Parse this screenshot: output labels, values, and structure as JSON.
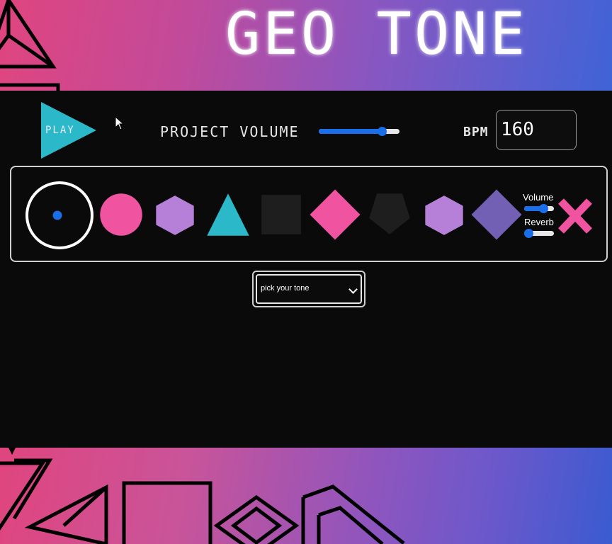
{
  "app": {
    "title": "GEO TONE"
  },
  "controls": {
    "play_label": "PLAY",
    "project_volume_label": "PROJECT VOLUME",
    "project_volume": 0.78,
    "bpm_label": "BPM",
    "bpm_value": "160"
  },
  "sequencer": {
    "steps": [
      {
        "shape": "ring-with-dot",
        "color": "#ffffff",
        "dot_color": "#1a6ee8"
      },
      {
        "shape": "circle",
        "color": "#f0539f"
      },
      {
        "shape": "hexagon",
        "color": "#b67fd8"
      },
      {
        "shape": "triangle",
        "color": "#2bb8c8"
      },
      {
        "shape": "square",
        "color": "#1e1e1e"
      },
      {
        "shape": "diamond",
        "color": "#f0539f"
      },
      {
        "shape": "pentagon",
        "color": "#1e1e1e"
      },
      {
        "shape": "hexagon",
        "color": "#b67fd8"
      },
      {
        "shape": "diamond",
        "color": "#7260b4"
      }
    ],
    "volume_label": "Volume",
    "volume": 0.65,
    "reverb_label": "Reverb",
    "reverb": 0.15,
    "delete_icon": "close-x-icon",
    "delete_color": "#f0539f"
  },
  "tone_picker": {
    "selected": "pick your tone"
  },
  "colors": {
    "accent_blue": "#1a6ee8",
    "pink": "#f0539f",
    "teal": "#2bb8c8",
    "purple": "#b67fd8"
  }
}
